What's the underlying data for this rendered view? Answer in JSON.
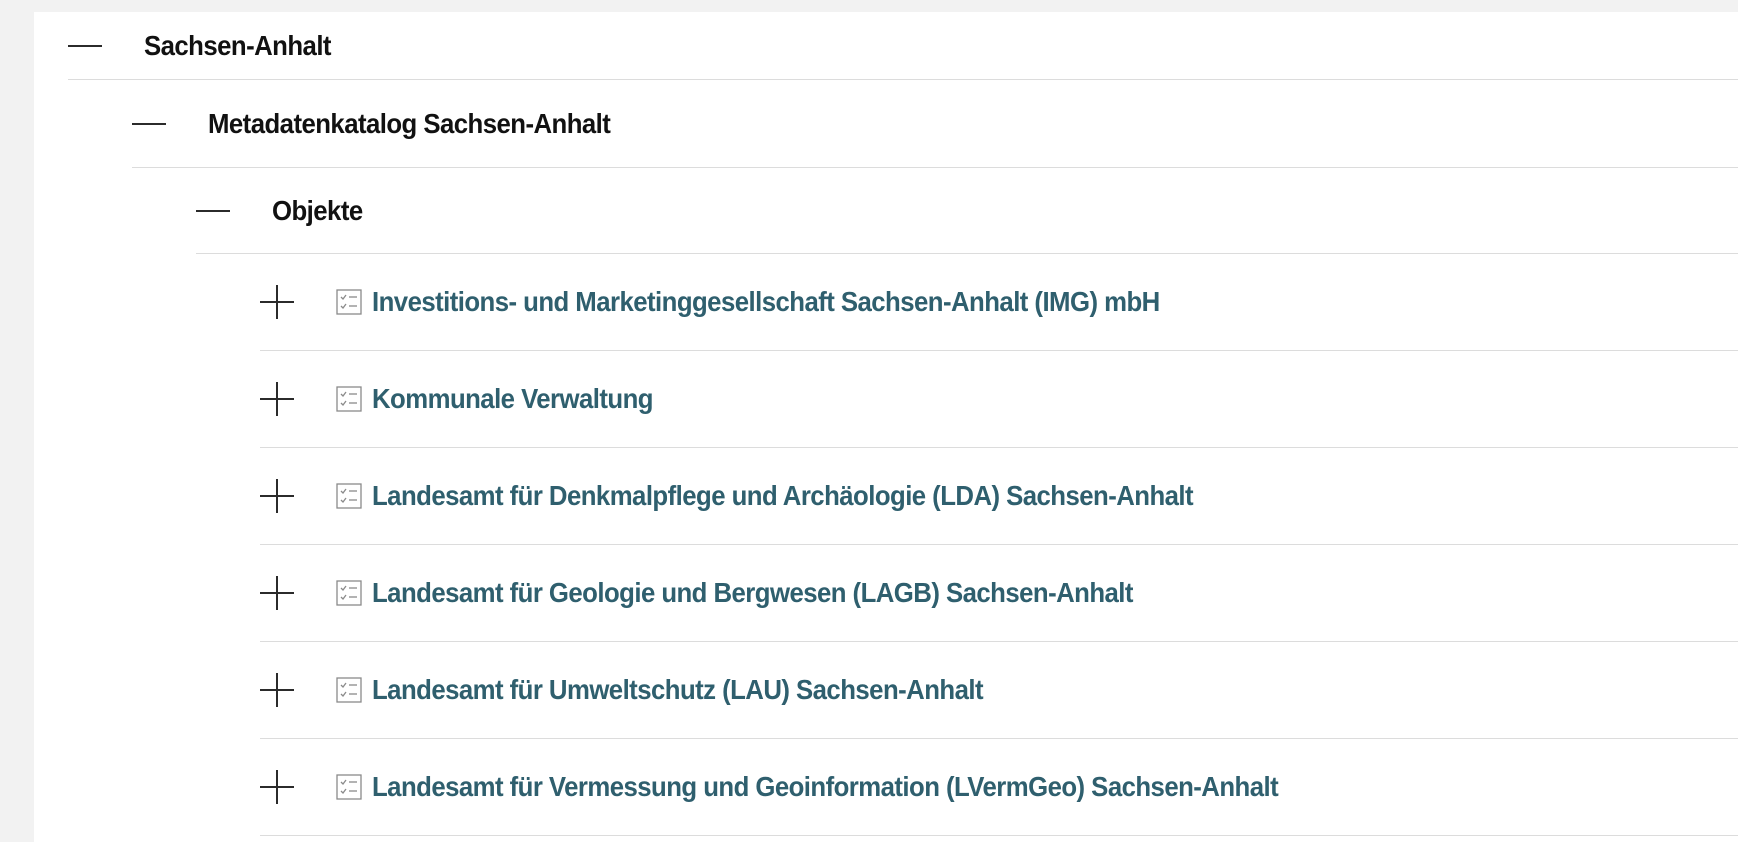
{
  "tree": {
    "root": {
      "label": "Sachsen-Anhalt",
      "state": "expanded",
      "child": {
        "label": "Metadatenkatalog Sachsen-Anhalt",
        "state": "expanded",
        "child": {
          "label": "Objekte",
          "state": "expanded",
          "items": [
            {
              "label": "Investitions- und Marketinggesellschaft Sachsen-Anhalt (IMG) mbH",
              "state": "collapsed",
              "icon": "checklist-icon"
            },
            {
              "label": "Kommunale Verwaltung",
              "state": "collapsed",
              "icon": "checklist-icon"
            },
            {
              "label": "Landesamt für Denkmalpflege und Archäologie (LDA) Sachsen-Anhalt",
              "state": "collapsed",
              "icon": "checklist-icon"
            },
            {
              "label": "Landesamt für Geologie und Bergwesen (LAGB) Sachsen-Anhalt",
              "state": "collapsed",
              "icon": "checklist-icon"
            },
            {
              "label": "Landesamt für Umweltschutz (LAU) Sachsen-Anhalt",
              "state": "collapsed",
              "icon": "checklist-icon"
            },
            {
              "label": "Landesamt für Vermessung und Geoinformation (LVermGeo) Sachsen-Anhalt",
              "state": "collapsed",
              "icon": "checklist-icon"
            }
          ]
        }
      }
    }
  },
  "colors": {
    "page_background": "#f2f2f2",
    "panel_background": "#ffffff",
    "heading_text": "#111111",
    "link_text": "#2f5f6e",
    "divider": "#dcdcdc",
    "icon_stroke": "#2b2b2b"
  }
}
